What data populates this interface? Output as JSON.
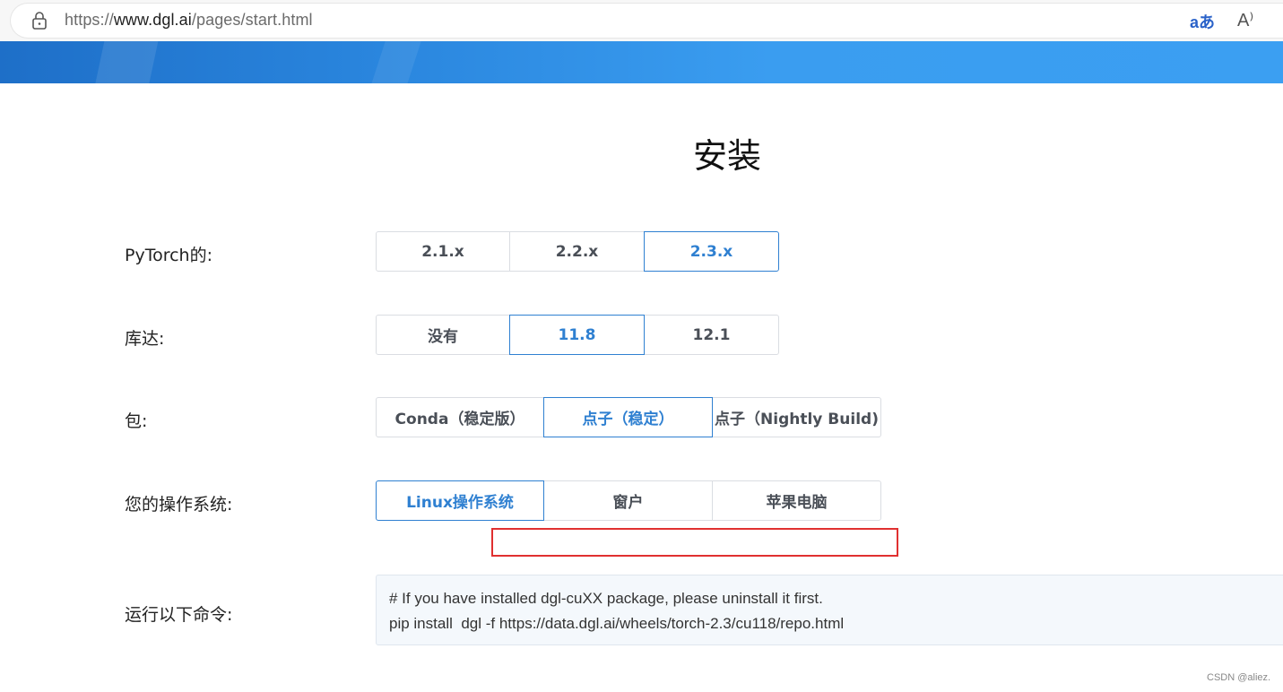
{
  "browser": {
    "url_prefix": "https://",
    "url_host": "www.dgl.ai",
    "url_path": "/pages/start.html",
    "translate_glyph": "aあ",
    "read_aloud_glyph": "A⁾"
  },
  "page": {
    "title": "安装"
  },
  "rows": [
    {
      "label": "PyTorch的:",
      "options": [
        "2.1.x",
        "2.2.x",
        "2.3.x"
      ],
      "selected": "2.3.x"
    },
    {
      "label": "库达:",
      "options": [
        "没有",
        "11.8",
        "12.1"
      ],
      "selected": "11.8"
    },
    {
      "label": "包:",
      "options": [
        "Conda（稳定版）",
        "点子（稳定）",
        "点子（Nightly Build)"
      ],
      "selected": "点子（稳定）"
    },
    {
      "label": "您的操作系统:",
      "options": [
        "Linux操作系统",
        "窗户",
        "苹果电脑"
      ],
      "selected": "Linux操作系统"
    }
  ],
  "command": {
    "label": "运行以下命令:",
    "line1": "# If you have installed dgl-cuXX package, please uninstall it first.",
    "line2": "pip install  dgl -f https://data.dgl.ai/wheels/torch-2.3/cu118/repo.html"
  },
  "watermark": "CSDN @aliez.",
  "colors": {
    "accent": "#2f80d1",
    "header": "#3b9ff2",
    "highlight": "#e03030"
  }
}
